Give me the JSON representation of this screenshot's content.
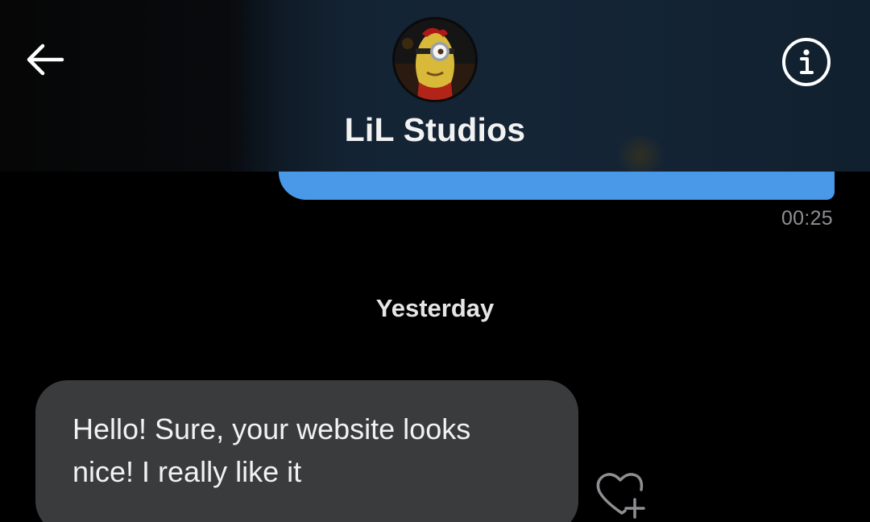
{
  "header": {
    "back_icon": "arrow-left-icon",
    "contact_name": "LiL Studios",
    "avatar_icon": "minion-avatar",
    "info_icon": "info-circle-icon"
  },
  "messages": {
    "outgoing": {
      "time": "00:25",
      "color": "#4a99e9"
    },
    "date_separator": "Yesterday",
    "incoming": {
      "text_line1": "Hello! Sure, your website looks",
      "text_line2": "nice! I really like it",
      "color": "#3a3b3d"
    },
    "react_icon": "heart-plus-icon"
  }
}
